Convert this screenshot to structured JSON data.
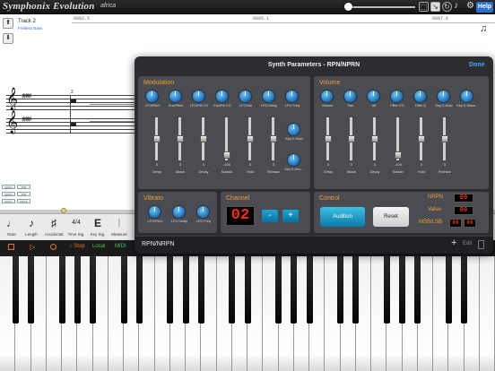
{
  "topbar": {
    "app_title": "Symphonix Evolution",
    "song_title": "africa",
    "help_label": "Help"
  },
  "track": {
    "up_arrow": "⬆",
    "down_arrow": "⬇",
    "name": "Track 2",
    "instrument": "Fretless Bass",
    "ruler": [
      "0002.5",
      "0005.1",
      "0007.6"
    ],
    "measure_number": "2",
    "small_buttons": [
      "SOLO",
      "TRK",
      "SOLO",
      "TRK",
      "SOLO",
      "MUTE"
    ]
  },
  "palette": {
    "items": [
      {
        "glyph": "♩",
        "label": "Note"
      },
      {
        "glyph": "♪",
        "label": "Length"
      },
      {
        "glyph": "♯",
        "label": "Accidental"
      },
      {
        "glyph": "4/4",
        "label": "Time Sig."
      },
      {
        "glyph": "E",
        "label": "Key Sig."
      },
      {
        "glyph": "𝄀",
        "label": "Measure"
      }
    ]
  },
  "transport": {
    "stop_label": "Stop",
    "local_label": "Local",
    "midi_label": "MIDI"
  },
  "synth_panel": {
    "title": "Synth Parameters - RPN/NPRN",
    "done_label": "Done",
    "modulation": {
      "title": "Modulation",
      "knobs": [
        "LFO/Pitch",
        "Env/Pitch",
        "LFO/Filt CO",
        "Env/Filt CO",
        "LFO/Vol",
        "LFO Delay",
        "LFO Freq"
      ],
      "extra_knobs": [
        "Key E.Hold",
        "Key E.Dec..."
      ],
      "faders": [
        {
          "label": "Delay",
          "value": "0",
          "level": 0.5
        },
        {
          "label": "Attack",
          "value": "0",
          "level": 0.5
        },
        {
          "label": "Decay",
          "value": "0",
          "level": 0.5
        },
        {
          "label": "Sustain",
          "value": "-100",
          "level": 0.05
        },
        {
          "label": "Hold",
          "value": "0",
          "level": 0.5
        },
        {
          "label": "Release",
          "value": "0",
          "level": 0.5
        }
      ]
    },
    "volume": {
      "title": "Volume",
      "knobs": [
        "Volume",
        "Pan",
        "Aft",
        "Filter CO",
        "Filter Q",
        "Key E.Hold",
        "Key E.Deca..."
      ],
      "faders": [
        {
          "label": "Delay",
          "value": "0",
          "level": 0.5
        },
        {
          "label": "Attack",
          "value": "0",
          "level": 0.5
        },
        {
          "label": "Decay",
          "value": "0",
          "level": 0.5
        },
        {
          "label": "Sustain",
          "value": "-100",
          "level": 0.05
        },
        {
          "label": "Hold",
          "value": "0",
          "level": 0.5
        },
        {
          "label": "Release",
          "value": "0",
          "level": 0.5
        }
      ]
    },
    "vibrato": {
      "title": "Vibrato",
      "knobs": [
        "LFO/Pitch",
        "LFO Delay",
        "LFO Freq"
      ]
    },
    "channel": {
      "title": "Channel",
      "value": "02",
      "minus_label": "-",
      "plus_label": "+"
    },
    "control": {
      "title": "Control",
      "audition_label": "Audition",
      "reset_label": "Reset",
      "nrpn_label": "NRPN",
      "value_label": "Value",
      "msb_lsb_label": "MSB/LSB",
      "nrpn_display": "00",
      "value_display": "00",
      "msb_display": "00",
      "lsb_display": "00"
    },
    "rpn_bar": {
      "title": "RPN/NRPN",
      "add_label": "+",
      "edit_label": "Edit"
    }
  },
  "colors": {
    "accent_orange": "#f0a030",
    "led_red": "#ff2a1a",
    "button_blue": "#0b8fc4",
    "help_blue": "#2a6fd6",
    "done_blue": "#4da6ff"
  }
}
